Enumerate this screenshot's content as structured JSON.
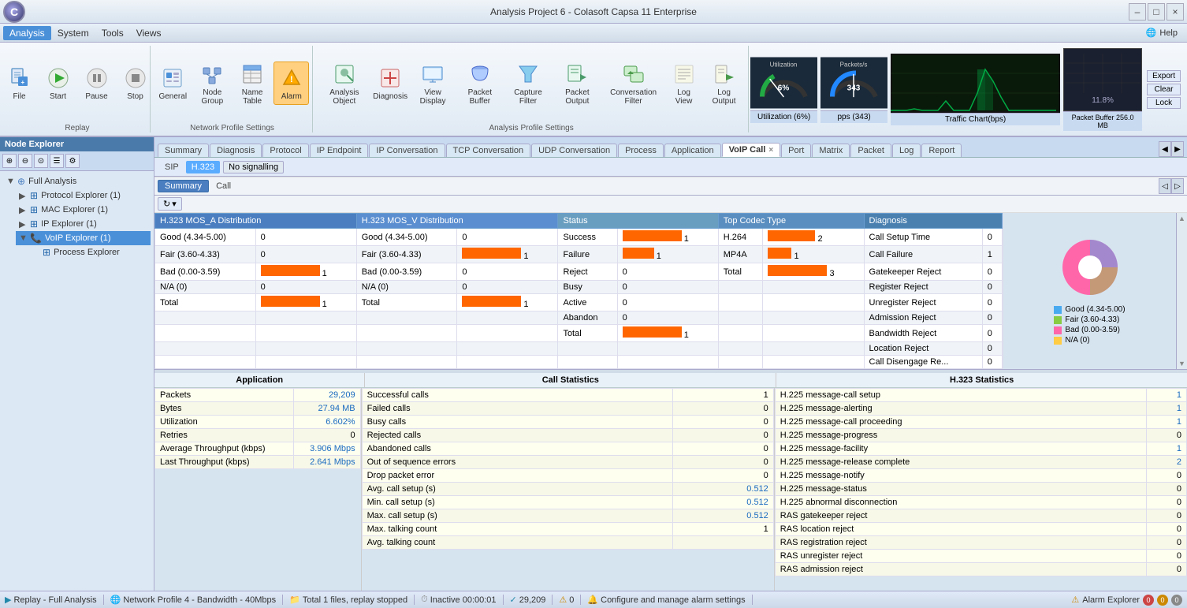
{
  "window": {
    "title": "Analysis Project 6 - Colasoft Capsa 11 Enterprise",
    "controls": [
      "–",
      "□",
      "×"
    ]
  },
  "menu": {
    "items": [
      "Analysis",
      "System",
      "Tools",
      "Views"
    ],
    "active": "Analysis",
    "help": "Help"
  },
  "toolbar": {
    "replay_group_label": "Replay",
    "network_profile_label": "Network Profile Settings",
    "analysis_profile_label": "Analysis Profile Settings",
    "buttons": [
      {
        "id": "file",
        "label": "File",
        "icon": "📄"
      },
      {
        "id": "start",
        "label": "Start",
        "icon": "▶"
      },
      {
        "id": "pause",
        "label": "Pause",
        "icon": "⏸"
      },
      {
        "id": "stop",
        "label": "Stop",
        "icon": "⏹"
      },
      {
        "id": "general",
        "label": "General",
        "icon": "📋"
      },
      {
        "id": "node-group",
        "label": "Node Group",
        "icon": "🖥"
      },
      {
        "id": "name-table",
        "label": "Name Table",
        "icon": "📊"
      },
      {
        "id": "alarm",
        "label": "Alarm",
        "icon": "🔔"
      },
      {
        "id": "analysis-object",
        "label": "Analysis Object",
        "icon": "🔍"
      },
      {
        "id": "diagnosis",
        "label": "Diagnosis",
        "icon": "🩺"
      },
      {
        "id": "view-display",
        "label": "View Display",
        "icon": "👁"
      },
      {
        "id": "packet-buffer",
        "label": "Packet Buffer",
        "icon": "📦"
      },
      {
        "id": "capture-filter",
        "label": "Capture Filter",
        "icon": "🔽"
      },
      {
        "id": "packet-output",
        "label": "Packet Output",
        "icon": "📤"
      },
      {
        "id": "conversation-filter",
        "label": "Conversation Filter",
        "icon": "💬"
      },
      {
        "id": "log-view",
        "label": "Log View",
        "icon": "📝"
      },
      {
        "id": "log-output",
        "label": "Log Output",
        "icon": "📃"
      }
    ],
    "right": {
      "utilization": "Utilization (6%)",
      "pps": "pps (343)",
      "traffic_label": "Traffic Chart(bps)",
      "packet_buffer": "Packet Buffer 256.0 MB",
      "percent": "11.8%",
      "export": "Export",
      "clear": "Clear",
      "lock": "Lock"
    }
  },
  "tabs": {
    "main_tabs": [
      {
        "id": "summary",
        "label": "Summary"
      },
      {
        "id": "diagnosis",
        "label": "Diagnosis"
      },
      {
        "id": "protocol",
        "label": "Protocol"
      },
      {
        "id": "ip-endpoint",
        "label": "IP Endpoint"
      },
      {
        "id": "ip-conversation",
        "label": "IP Conversation"
      },
      {
        "id": "tcp-conversation",
        "label": "TCP Conversation"
      },
      {
        "id": "udp-conversation",
        "label": "UDP Conversation"
      },
      {
        "id": "process",
        "label": "Process"
      },
      {
        "id": "application",
        "label": "Application"
      },
      {
        "id": "voip-call",
        "label": "VoIP Call",
        "active": true,
        "closeable": true
      },
      {
        "id": "port",
        "label": "Port"
      },
      {
        "id": "matrix",
        "label": "Matrix"
      },
      {
        "id": "packet",
        "label": "Packet"
      },
      {
        "id": "log",
        "label": "Log"
      },
      {
        "id": "report",
        "label": "Report"
      }
    ],
    "sub_tabs": [
      {
        "id": "sip",
        "label": "SIP"
      },
      {
        "id": "h323",
        "label": "H.323",
        "active": true
      },
      {
        "id": "no-signaling",
        "label": "No signalling"
      }
    ],
    "view_tabs": [
      {
        "id": "summary",
        "label": "Summary",
        "active": true
      },
      {
        "id": "call",
        "label": "Call"
      }
    ]
  },
  "sidebar": {
    "title": "Node Explorer",
    "tree": [
      {
        "id": "full-analysis",
        "label": "Full Analysis",
        "type": "root",
        "expanded": true,
        "children": [
          {
            "id": "protocol-explorer",
            "label": "Protocol Explorer (1)",
            "type": "protocol"
          },
          {
            "id": "mac-explorer",
            "label": "MAC Explorer (1)",
            "type": "mac"
          },
          {
            "id": "ip-explorer",
            "label": "IP Explorer (1)",
            "type": "ip"
          },
          {
            "id": "voip-explorer",
            "label": "VoIP Explorer (1)",
            "type": "voip",
            "selected": true,
            "children": [
              {
                "id": "process-explorer-child",
                "label": "Process Explorer",
                "type": "process"
              }
            ]
          }
        ]
      }
    ]
  },
  "voip_summary": {
    "sections": {
      "mos_a": {
        "header": "H.323 MOS_A Distribution",
        "rows": [
          {
            "label": "Good (4.34-5.00)",
            "value": 0,
            "bar": 0
          },
          {
            "label": "Fair (3.60-4.33)",
            "value": 0,
            "bar": 0
          },
          {
            "label": "Bad (0.00-3.59)",
            "value": 1,
            "bar": 80
          },
          {
            "label": "N/A (0)",
            "value": 0,
            "bar": 0
          },
          {
            "label": "Total",
            "value": 1,
            "bar": 80
          }
        ]
      },
      "mos_v": {
        "header": "H.323 MOS_V Distribution",
        "rows": [
          {
            "label": "Good (4.34-5.00)",
            "value": 0,
            "bar": 0
          },
          {
            "label": "Fair (3.60-4.33)",
            "value": 1,
            "bar": 80
          },
          {
            "label": "Bad (0.00-3.59)",
            "value": 0,
            "bar": 0
          },
          {
            "label": "N/A (0)",
            "value": 0,
            "bar": 0
          },
          {
            "label": "Total",
            "value": 1,
            "bar": 80
          }
        ]
      },
      "status": {
        "header": "Status",
        "rows": [
          {
            "label": "Success",
            "value": 1,
            "bar": 80
          },
          {
            "label": "Failure",
            "value": 1,
            "bar": 40
          },
          {
            "label": "Reject",
            "value": 0,
            "bar": 0
          },
          {
            "label": "Busy",
            "value": 0,
            "bar": 0
          },
          {
            "label": "Active",
            "value": 0,
            "bar": 0
          },
          {
            "label": "Abandon",
            "value": 0,
            "bar": 0
          },
          {
            "label": "Total",
            "value": 1,
            "bar": 80
          }
        ]
      },
      "codec": {
        "header": "Top Codec Type",
        "rows": [
          {
            "label": "H.264",
            "value": 2,
            "bar": 80
          },
          {
            "label": "MP4A",
            "value": 1,
            "bar": 40
          },
          {
            "label": "Total",
            "value": 3,
            "bar": 100
          }
        ]
      },
      "diagnosis": {
        "header": "Diagnosis",
        "rows": [
          {
            "label": "Call Setup Time",
            "value": 0
          },
          {
            "label": "Call Failure",
            "value": 1
          },
          {
            "label": "Gatekeeper Reject",
            "value": 0
          },
          {
            "label": "Register Reject",
            "value": 0
          },
          {
            "label": "Unregister Reject",
            "value": 0
          },
          {
            "label": "Admission Reject",
            "value": 0
          },
          {
            "label": "Bandwidth Reject",
            "value": 0
          },
          {
            "label": "Location Reject",
            "value": 0
          },
          {
            "label": "Call Disengage Re...",
            "value": 0
          }
        ]
      }
    },
    "pie_legend": [
      {
        "label": "Good (4.34-5.00)",
        "color": "#4aaaf0"
      },
      {
        "label": "Fair (3.60-4.33)",
        "color": "#88cc44"
      },
      {
        "label": "Bad (0.00-3.59)",
        "color": "#ff66aa"
      },
      {
        "label": "N/A (0)",
        "color": "#ffcc44"
      }
    ],
    "application": {
      "header": "Application",
      "rows": [
        {
          "label": "Packets",
          "value": "29,209",
          "color": "blue"
        },
        {
          "label": "Bytes",
          "value": "27.94 MB",
          "color": "blue"
        },
        {
          "label": "Utilization",
          "value": "6.602%",
          "color": "blue"
        },
        {
          "label": "Retries",
          "value": "0",
          "color": "black"
        },
        {
          "label": "Average Throughput (kbps)",
          "value": "3.906 Mbps",
          "color": "blue"
        },
        {
          "label": "Last Throughput (kbps)",
          "value": "2.641 Mbps",
          "color": "blue"
        }
      ]
    },
    "call_statistics": {
      "header": "Call Statistics",
      "rows": [
        {
          "label": "Successful calls",
          "value": "1",
          "color": "black"
        },
        {
          "label": "Failed calls",
          "value": "0",
          "color": "black"
        },
        {
          "label": "Busy calls",
          "value": "0",
          "color": "black"
        },
        {
          "label": "Rejected calls",
          "value": "0",
          "color": "black"
        },
        {
          "label": "Abandoned calls",
          "value": "0",
          "color": "black"
        },
        {
          "label": "Out of sequence errors",
          "value": "0",
          "color": "black"
        },
        {
          "label": "Drop packet error",
          "value": "0",
          "color": "black"
        },
        {
          "label": "Avg. call setup (s)",
          "value": "0.512",
          "color": "blue"
        },
        {
          "label": "Min. call setup (s)",
          "value": "0.512",
          "color": "blue"
        },
        {
          "label": "Max. call setup (s)",
          "value": "0.512",
          "color": "blue"
        },
        {
          "label": "Max. talking count",
          "value": "1",
          "color": "black"
        },
        {
          "label": "Avg. talking count",
          "value": "",
          "color": "black"
        }
      ]
    },
    "h323_statistics": {
      "header": "H.323 Statistics",
      "rows": [
        {
          "label": "H.225 message-call setup",
          "value": "1",
          "color": "blue"
        },
        {
          "label": "H.225 message-alerting",
          "value": "1",
          "color": "blue"
        },
        {
          "label": "H.225 message-call proceeding",
          "value": "1",
          "color": "blue"
        },
        {
          "label": "H.225 message-progress",
          "value": "0",
          "color": "black"
        },
        {
          "label": "H.225 message-facility",
          "value": "1",
          "color": "blue"
        },
        {
          "label": "H.225 message-release complete",
          "value": "2",
          "color": "blue"
        },
        {
          "label": "H.225 message-notify",
          "value": "0",
          "color": "black"
        },
        {
          "label": "H.225 message-status",
          "value": "0",
          "color": "black"
        },
        {
          "label": "H.225 abnormal disconnection",
          "value": "0",
          "color": "black"
        },
        {
          "label": "RAS gatekeeper reject",
          "value": "0",
          "color": "black"
        },
        {
          "label": "RAS location reject",
          "value": "0",
          "color": "black"
        },
        {
          "label": "RAS registration reject",
          "value": "0",
          "color": "black"
        },
        {
          "label": "RAS unregister reject",
          "value": "0",
          "color": "black"
        },
        {
          "label": "RAS admission reject",
          "value": "0",
          "color": "black"
        }
      ]
    }
  },
  "status_bar": {
    "items": [
      {
        "id": "replay",
        "label": "Replay - Full Analysis",
        "icon": "▶"
      },
      {
        "id": "network-profile",
        "label": "Network Profile 4 - Bandwidth - 40Mbps",
        "icon": "🌐"
      },
      {
        "id": "files",
        "label": "Total 1 files, replay stopped",
        "icon": "📁"
      },
      {
        "id": "inactive",
        "label": "Inactive  00:00:01",
        "icon": "⏱"
      },
      {
        "id": "packets",
        "label": "29,209",
        "icon": "✓"
      },
      {
        "id": "errors",
        "label": "0",
        "icon": "⚠"
      },
      {
        "id": "alarm-config",
        "label": "Configure and manage alarm settings"
      },
      {
        "id": "alarm-explorer",
        "label": "Alarm Explorer"
      },
      {
        "id": "alarm-count-1",
        "label": "0"
      },
      {
        "id": "alarm-count-2",
        "label": "0"
      },
      {
        "id": "alarm-count-3",
        "label": "0"
      }
    ]
  }
}
